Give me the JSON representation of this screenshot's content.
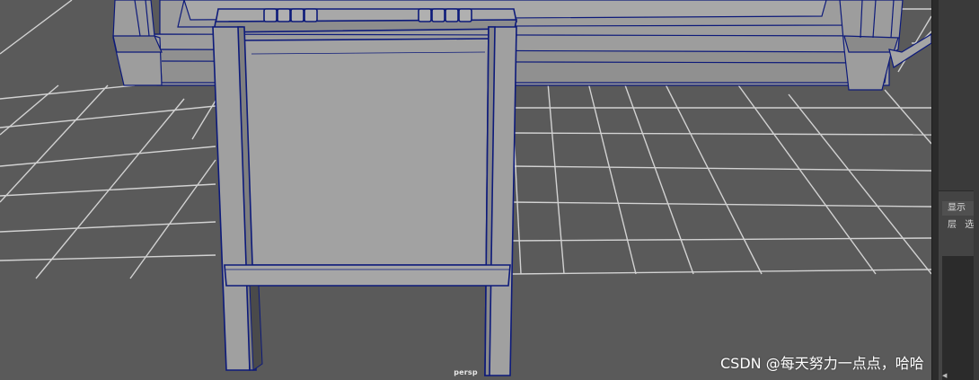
{
  "viewport": {
    "camera_label": "persp",
    "colors": {
      "background": "#5a5a5a",
      "grid_line": "#d4d4d4",
      "model_face": "#9d9d9d",
      "model_face_light": "#a7a7a7",
      "model_face_dark": "#7f7f7f",
      "wireframe": "#0d1a7a"
    }
  },
  "side_panel": {
    "display_menu": "显示",
    "tabs": [
      "层",
      "选"
    ]
  },
  "watermark": "CSDN @每天努力一点点，哈哈"
}
